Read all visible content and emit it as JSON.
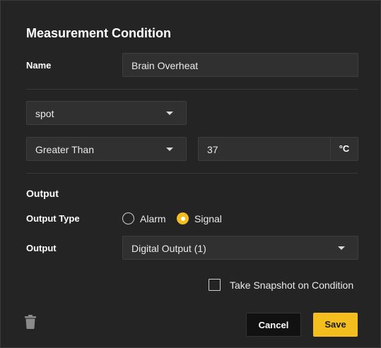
{
  "dialog": {
    "title": "Measurement Condition",
    "name_label": "Name",
    "name_value": "Brain Overheat",
    "spot_select": "spot",
    "comparison_select": "Greater Than",
    "threshold_value": "37",
    "threshold_unit": "°C",
    "output_section_title": "Output",
    "output_type_label": "Output Type",
    "output_type_options": [
      "Alarm",
      "Signal"
    ],
    "output_type_selected": "Signal",
    "output_label": "Output",
    "output_select": "Digital Output (1)",
    "snapshot_label": "Take Snapshot on Condition",
    "snapshot_checked": false,
    "cancel_label": "Cancel",
    "save_label": "Save"
  },
  "colors": {
    "accent": "#f5be1f",
    "background": "#242424",
    "field": "#303030"
  },
  "icons": {
    "delete": "trash-icon",
    "dropdown": "chevron-down-icon"
  }
}
